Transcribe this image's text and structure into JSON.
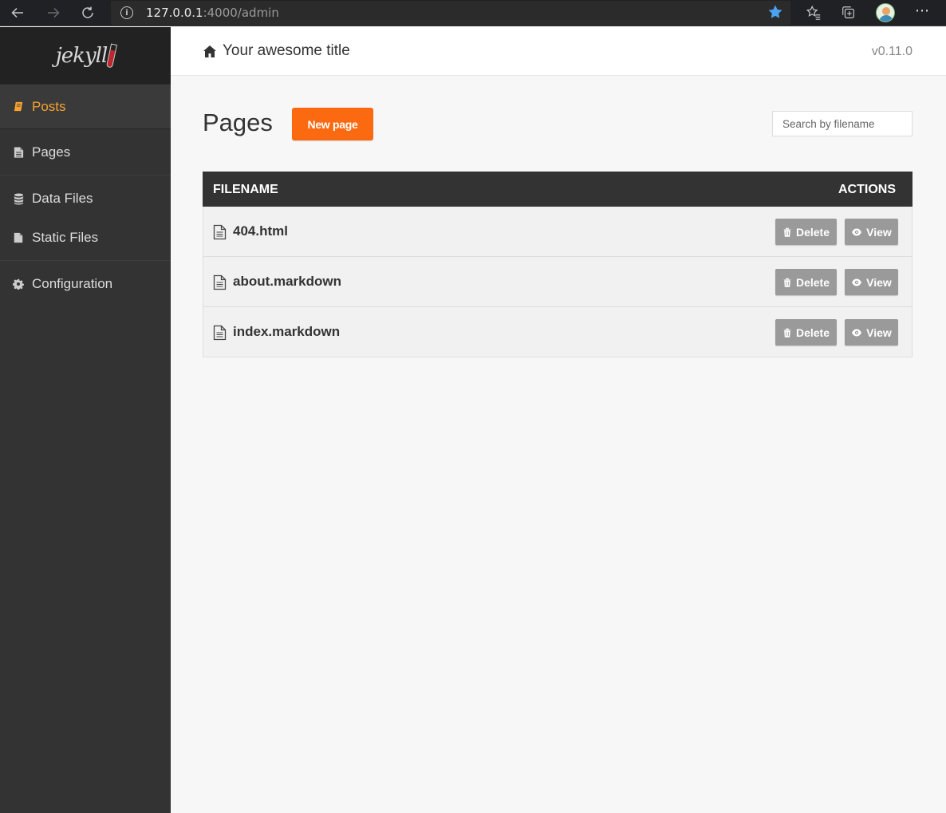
{
  "browser": {
    "url_host": "127.0.0.1",
    "url_path": ":4000/admin"
  },
  "sidebar": {
    "logo_text": "jekyll",
    "items": [
      {
        "label": "Posts",
        "icon": "book-icon",
        "active": true
      },
      {
        "label": "Pages",
        "icon": "file-text-icon",
        "active": false
      },
      {
        "label": "Data Files",
        "icon": "database-icon",
        "active": false
      },
      {
        "label": "Static Files",
        "icon": "file-icon",
        "active": false
      },
      {
        "label": "Configuration",
        "icon": "gear-icon",
        "active": false
      }
    ]
  },
  "header": {
    "site_title": "Your awesome title",
    "version": "v0.11.0"
  },
  "main": {
    "heading": "Pages",
    "new_button": "New page",
    "search_placeholder": "Search by filename",
    "table": {
      "columns": [
        "FILENAME",
        "ACTIONS"
      ],
      "rows": [
        {
          "filename": "404.html"
        },
        {
          "filename": "about.markdown"
        },
        {
          "filename": "index.markdown"
        }
      ],
      "delete_label": "Delete",
      "view_label": "View"
    }
  },
  "colors": {
    "accent": "#fb6a10",
    "active_nav": "#f7a230",
    "sidebar_bg": "#333333",
    "button_gray": "#9a9a9a"
  }
}
